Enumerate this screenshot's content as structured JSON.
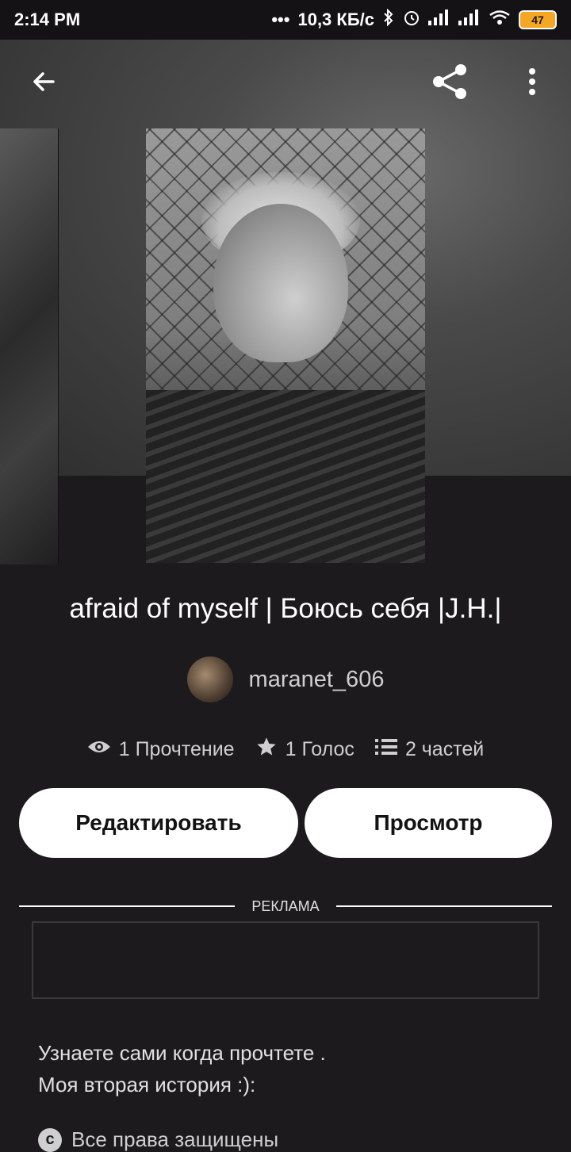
{
  "status_bar": {
    "time": "2:14 PM",
    "net_speed": "10,3 КБ/с",
    "battery": "47"
  },
  "story": {
    "title": "afraid of myself | Боюсь себя |J.H.|",
    "author": "maranet_606",
    "stats": {
      "reads": "1 Прочтение",
      "votes": "1 Голос",
      "parts": "2 частей"
    }
  },
  "actions": {
    "edit_label": "Редактировать",
    "view_label": "Просмотр"
  },
  "ad": {
    "label": "РЕКЛАМА"
  },
  "description": {
    "line1": "Узнаете сами когда прочтете .",
    "line2": "Моя вторая история :):"
  },
  "rights": {
    "text": "Все права защищены"
  },
  "icons": {
    "back": "arrow-back-icon",
    "share": "share-icon",
    "more": "more-vert-icon",
    "reads": "eye-icon",
    "votes": "star-icon",
    "parts": "list-icon",
    "rights": "copyright-icon"
  },
  "colors": {
    "background": "#1c1a1d",
    "button": "#ffffff",
    "battery": "#f5a623"
  }
}
